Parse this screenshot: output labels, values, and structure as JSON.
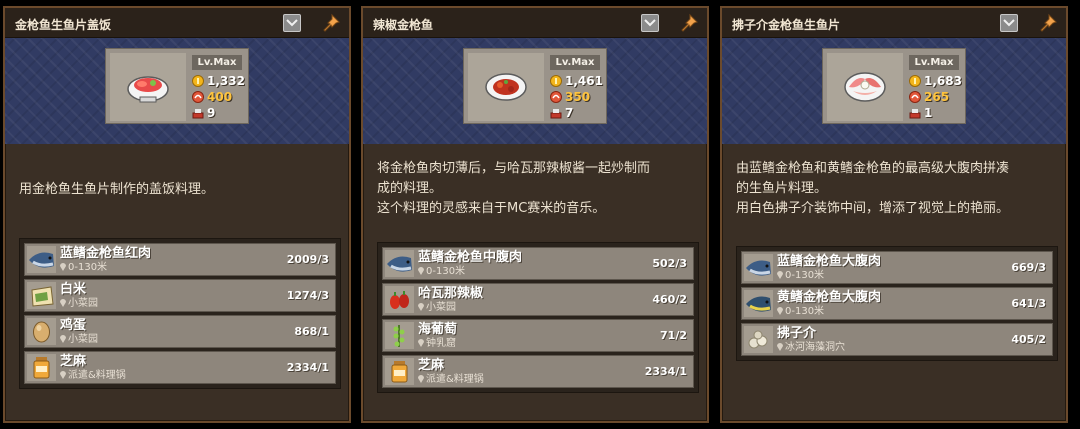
{
  "panels": [
    {
      "title": "金枪鱼生鱼片盖饭",
      "level": "Lv.Max",
      "price": "1,332",
      "taste": "400",
      "servings": "9",
      "dish_icon": "rice-bowl-icon",
      "description": [
        "用金枪鱼生鱼片制作的盖饭料理。"
      ],
      "ingredients": [
        {
          "name": "蓝鳍金枪鱼红肉",
          "location": "0-130米",
          "count": "2009/3",
          "icon": "tuna-icon"
        },
        {
          "name": "白米",
          "location": "小菜园",
          "count": "1274/3",
          "icon": "rice-sack-icon"
        },
        {
          "name": "鸡蛋",
          "location": "小菜园",
          "count": "868/1",
          "icon": "egg-icon"
        },
        {
          "name": "芝麻",
          "location": "派遣&料理锅",
          "count": "2334/1",
          "icon": "sesame-jar-icon"
        }
      ]
    },
    {
      "title": "辣椒金枪鱼",
      "level": "Lv.Max",
      "price": "1,461",
      "taste": "350",
      "servings": "7",
      "dish_icon": "chili-tuna-plate-icon",
      "description": [
        "将金枪鱼肉切薄后，与哈瓦那辣椒酱一起炒制而",
        "成的料理。",
        "这个料理的灵感来自于MC赛米的音乐。"
      ],
      "ingredients": [
        {
          "name": "蓝鳍金枪鱼中腹肉",
          "location": "0-130米",
          "count": "502/3",
          "icon": "tuna-icon"
        },
        {
          "name": "哈瓦那辣椒",
          "location": "小菜园",
          "count": "460/2",
          "icon": "chili-pepper-icon"
        },
        {
          "name": "海葡萄",
          "location": "钟乳窟",
          "count": "71/2",
          "icon": "sea-grape-icon"
        },
        {
          "name": "芝麻",
          "location": "派遣&料理锅",
          "count": "2334/1",
          "icon": "sesame-jar-icon"
        }
      ]
    },
    {
      "title": "拂子介金枪鱼生鱼片",
      "level": "Lv.Max",
      "price": "1,683",
      "taste": "265",
      "servings": "1",
      "dish_icon": "sashimi-plate-icon",
      "description": [
        "由蓝鳍金枪鱼和黄鳍金枪鱼的最高级大腹肉拼凑",
        "的生鱼片料理。",
        "用白色拂子介装饰中间，增添了视觉上的艳丽。"
      ],
      "ingredients": [
        {
          "name": "蓝鳍金枪鱼大腹肉",
          "location": "0-130米",
          "count": "669/3",
          "icon": "tuna-icon"
        },
        {
          "name": "黄鳍金枪鱼大腹肉",
          "location": "0-130米",
          "count": "641/3",
          "icon": "yellowfin-tuna-icon"
        },
        {
          "name": "拂子介",
          "location": "冰河海藻洞穴",
          "count": "405/2",
          "icon": "barnacle-icon"
        }
      ]
    }
  ],
  "colors": {
    "panel_bg": "#3a2f25",
    "panel_border": "#6b4a2c",
    "hero_bg": "#313b63",
    "ingredient_row": "#8e867c",
    "taste_value": "#ffc43d"
  }
}
